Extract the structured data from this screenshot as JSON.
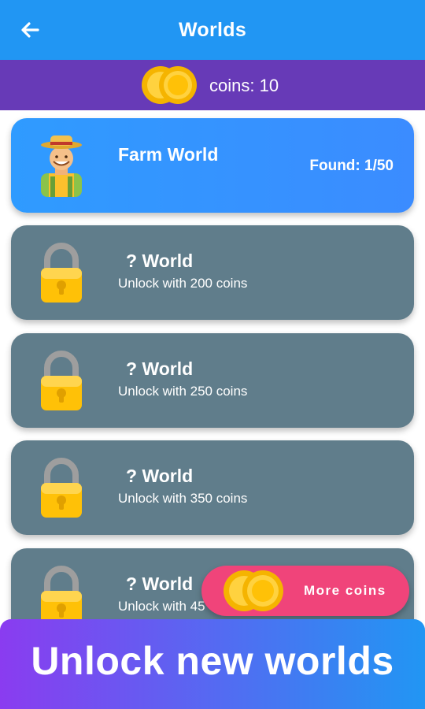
{
  "appbar": {
    "title": "Worlds",
    "back_icon": "arrow-left-icon"
  },
  "coinbar": {
    "label": "coins: 10",
    "icon": "coins-icon"
  },
  "worlds": [
    {
      "name": "Farm World",
      "found": "Found: 1/50",
      "icon": "farmer-icon",
      "locked": false
    },
    {
      "name": "?  World",
      "subtitle": "Unlock with 200 coins",
      "icon": "lock-icon",
      "locked": true
    },
    {
      "name": "?  World",
      "subtitle": "Unlock with 250 coins",
      "icon": "lock-icon",
      "locked": true
    },
    {
      "name": "?  World",
      "subtitle": "Unlock with 350 coins",
      "icon": "lock-icon",
      "locked": true
    },
    {
      "name": "?  World",
      "subtitle": "Unlock with 45",
      "icon": "lock-icon",
      "locked": true
    }
  ],
  "more_coins": {
    "label": "More coins",
    "icon": "coins-icon"
  },
  "banner": {
    "text": "Unlock new worlds"
  },
  "colors": {
    "appbar": "#2196f3",
    "coinbar": "#673ab7",
    "locked_card": "#607d8b",
    "unlocked_card": "#2f9bff",
    "more_coins_button": "#f0447a",
    "banner_start": "#8a3cf0",
    "banner_end": "#2196f3"
  }
}
